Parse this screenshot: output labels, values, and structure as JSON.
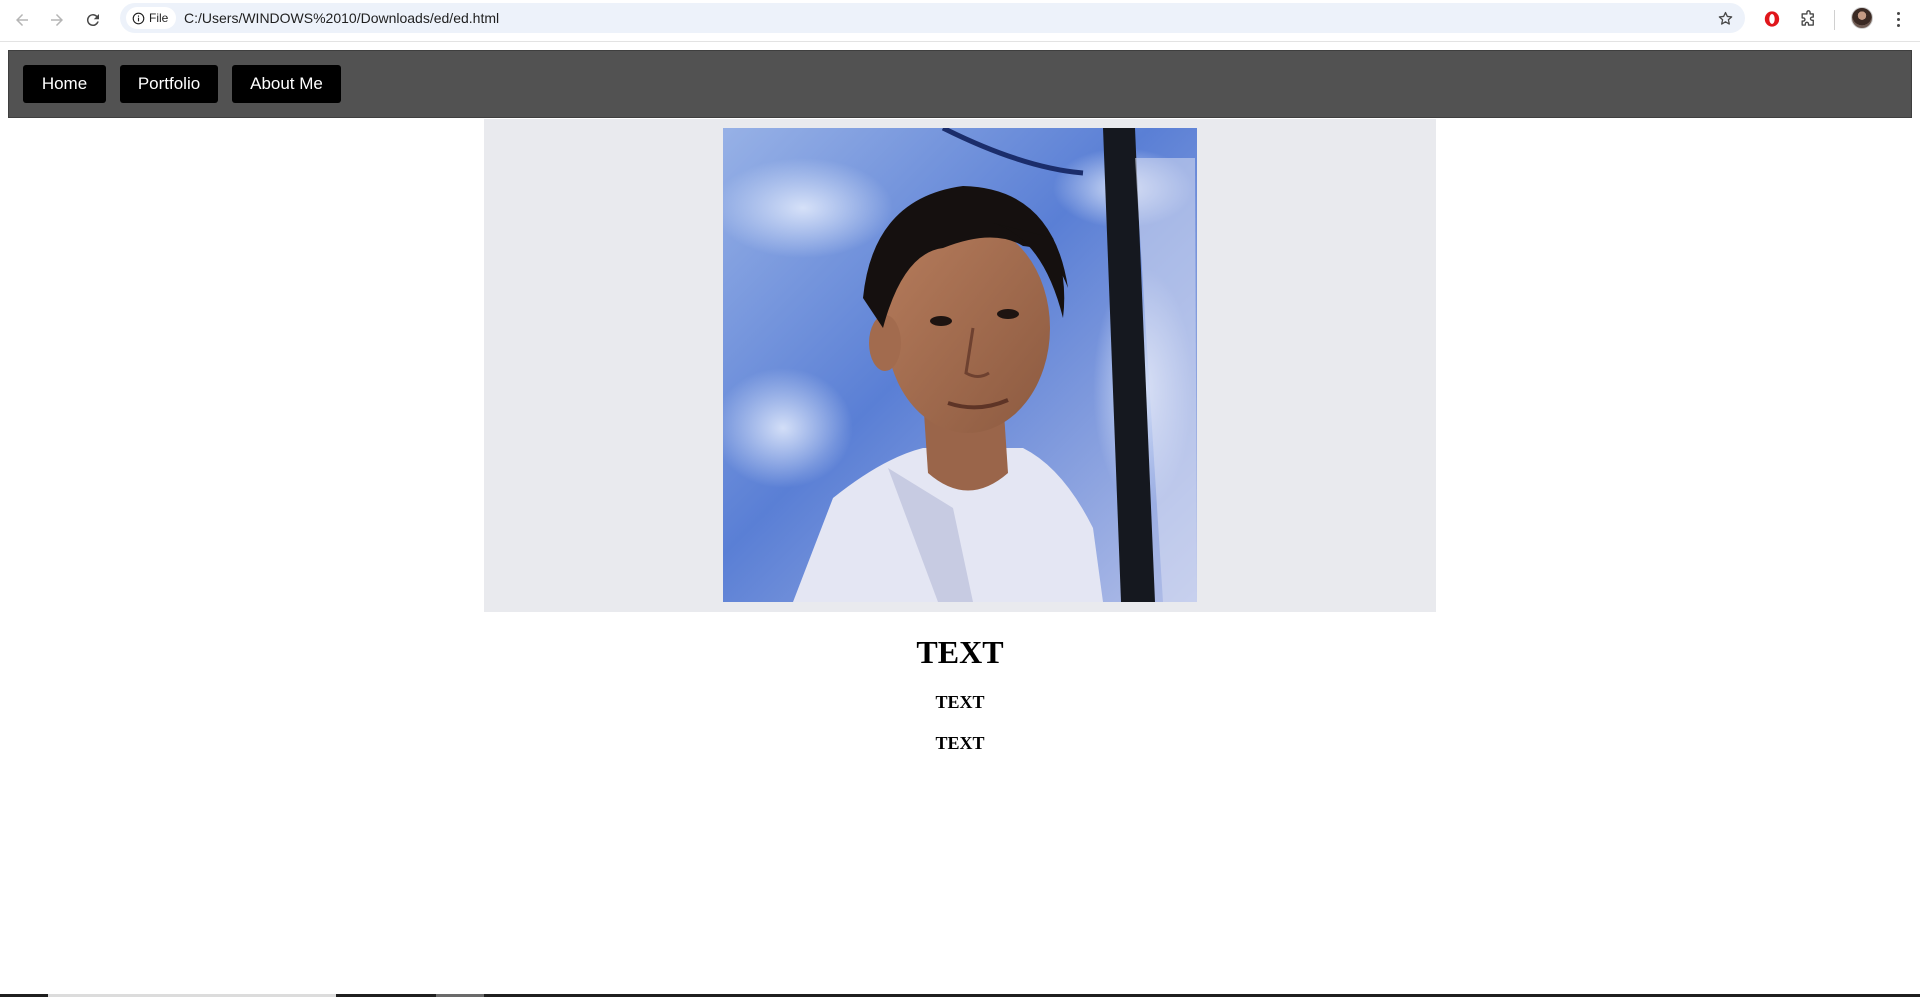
{
  "browser": {
    "site_chip_label": "File",
    "url": "C:/Users/WINDOWS%2010/Downloads/ed/ed.html",
    "icons": {
      "back": "arrow-left-icon",
      "forward": "arrow-right-icon",
      "reload": "reload-icon",
      "site_info": "info-icon",
      "bookmark": "star-icon",
      "opera": "opera-extension-icon",
      "extensions": "puzzle-icon",
      "profile": "avatar",
      "menu": "more-vert-icon"
    },
    "colors": {
      "omnibox_bg": "#edf2fa",
      "opera_red": "#e0161b"
    }
  },
  "page": {
    "nav": {
      "items": [
        {
          "label": "Home"
        },
        {
          "label": "Portfolio"
        },
        {
          "label": "About Me"
        }
      ],
      "bar_color": "#525252",
      "button_color": "#000000"
    },
    "hero": {
      "photo_alt": "profile-photo",
      "bg_color": "#e9eaee"
    },
    "heading": "TEXT",
    "subheading_1": "TEXT",
    "subheading_2": "TEXT"
  }
}
